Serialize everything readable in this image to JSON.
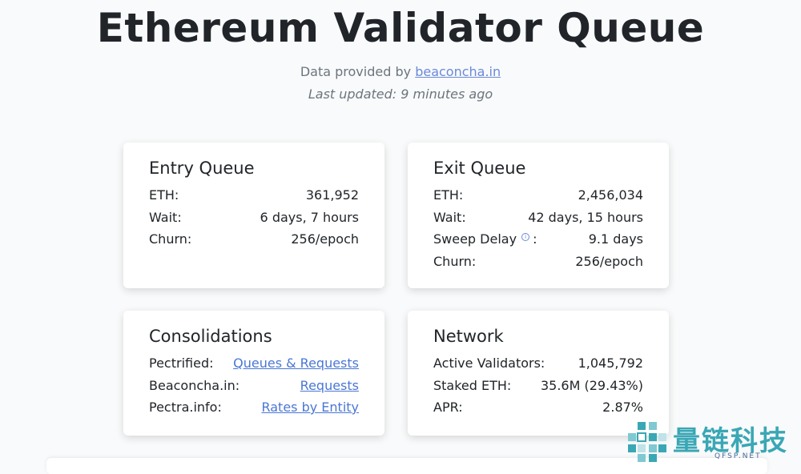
{
  "header": {
    "title": "Ethereum Validator Queue",
    "provided_prefix": "Data provided by",
    "provider_link": "beaconcha.in",
    "last_updated": "Last updated: 9 minutes ago"
  },
  "entry_queue": {
    "title": "Entry Queue",
    "rows": [
      {
        "label": "ETH:",
        "value": "361,952"
      },
      {
        "label": "Wait:",
        "value": "6 days, 7 hours"
      },
      {
        "label": "Churn:",
        "value": "256/epoch"
      }
    ]
  },
  "exit_queue": {
    "title": "Exit Queue",
    "rows": [
      {
        "label": "ETH:",
        "value": "2,456,034"
      },
      {
        "label": "Wait:",
        "value": "42 days, 15 hours"
      },
      {
        "label": "Sweep Delay",
        "suffix": ":",
        "value": "9.1 days"
      },
      {
        "label": "Churn:",
        "value": "256/epoch"
      }
    ]
  },
  "consolidations": {
    "title": "Consolidations",
    "rows": [
      {
        "label": "Pectrified:",
        "link": "Queues & Requests"
      },
      {
        "label": "Beaconcha.in:",
        "link": "Requests"
      },
      {
        "label": "Pectra.info:",
        "link": "Rates by Entity"
      }
    ]
  },
  "network": {
    "title": "Network",
    "rows": [
      {
        "label": "Active Validators:",
        "value": "1,045,792"
      },
      {
        "label": "Staked ETH:",
        "value": "35.6M (29.43%)"
      },
      {
        "label": "APR:",
        "value": "2.87%"
      }
    ]
  },
  "watermark": {
    "text": "量链科技",
    "sub": "QFSP.NET"
  },
  "icons": {
    "info": "info-circle-icon",
    "logo": "qfsp-logo-icon"
  },
  "colors": {
    "link": "#4a77d4",
    "watermark": "#3aa7b5"
  }
}
